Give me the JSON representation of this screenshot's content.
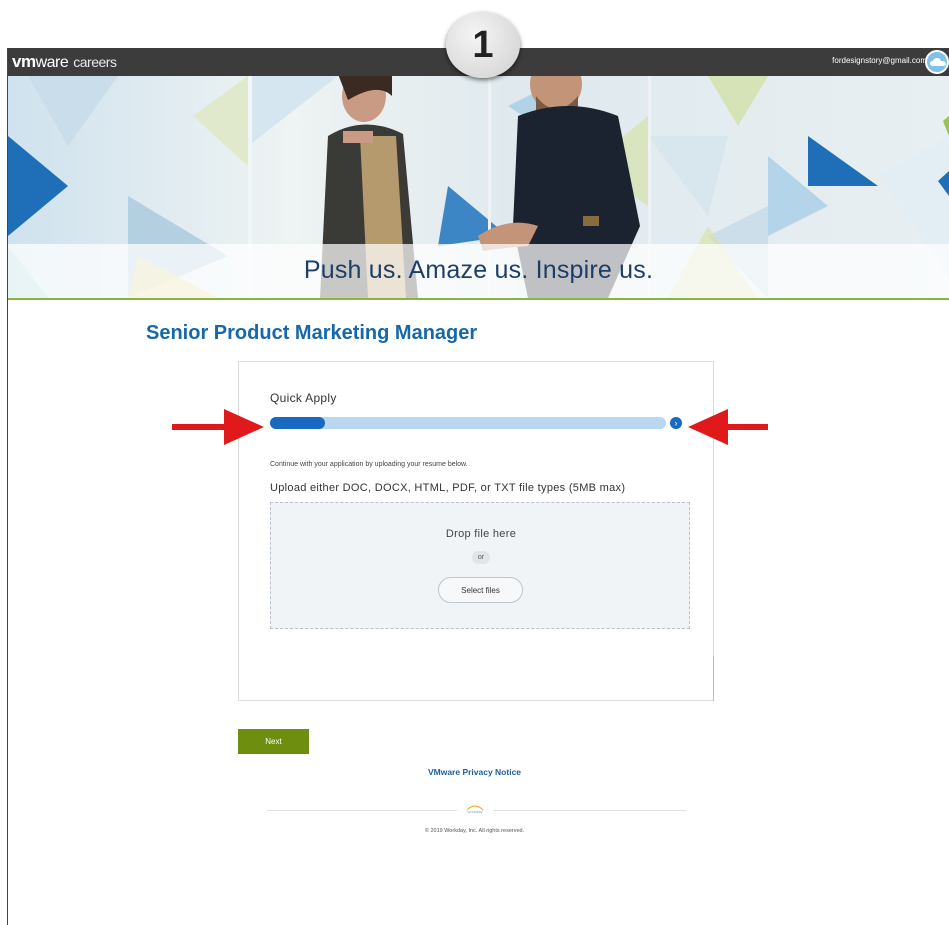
{
  "header": {
    "logo_vm": "vm",
    "logo_ware": "ware",
    "logo_careers": "careers",
    "user_email": "fordesignstory@gmail.com"
  },
  "step_badge": "1",
  "hero": {
    "tagline": "Push us. Amaze us. Inspire us."
  },
  "job": {
    "title": "Senior Product Marketing Manager"
  },
  "apply": {
    "heading": "Quick Apply",
    "progress_fraction": 0.14,
    "progress_next_icon": "›",
    "instructions": "Continue with your application by uploading your resume below.",
    "upload_types": "Upload either DOC, DOCX, HTML, PDF, or TXT file types (5MB max)",
    "drop_label": "Drop file here",
    "or_label": "or",
    "select_files_label": "Select files"
  },
  "footer": {
    "next_label": "Next",
    "privacy_link": "VMware Privacy Notice",
    "workday_logo": "workday",
    "copyright": "© 2019 Workday, Inc. All rights reserved."
  },
  "colors": {
    "accent_blue": "#1869c2",
    "title_blue": "#1768a8",
    "next_green": "#6e8e10",
    "annotation_red": "#e0191b",
    "topbar": "#3c3c3c"
  }
}
